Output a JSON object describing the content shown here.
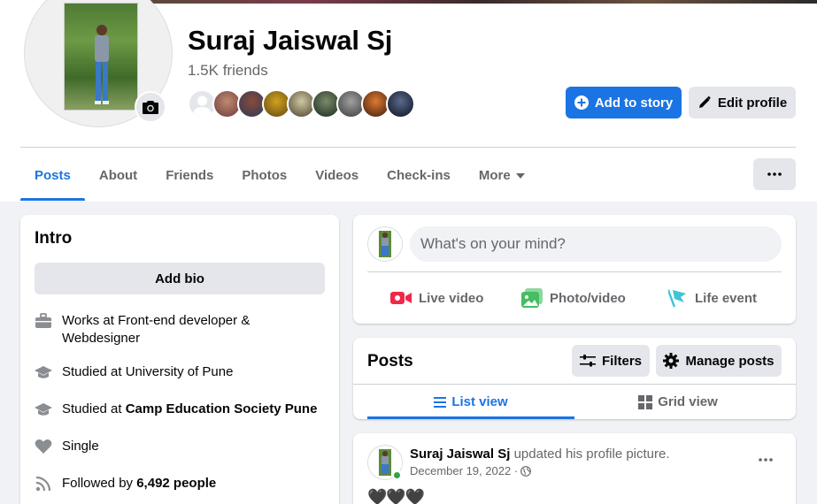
{
  "profile": {
    "name": "Suraj Jaiswal Sj",
    "friends_count": "1.5K friends",
    "add_to_story_label": "Add to story",
    "edit_profile_label": "Edit profile"
  },
  "tabs": [
    {
      "label": "Posts",
      "active": true
    },
    {
      "label": "About"
    },
    {
      "label": "Friends"
    },
    {
      "label": "Photos"
    },
    {
      "label": "Videos"
    },
    {
      "label": "Check-ins"
    },
    {
      "label": "More"
    }
  ],
  "intro": {
    "title": "Intro",
    "add_bio_label": "Add bio",
    "items": [
      {
        "icon": "briefcase-icon",
        "text": "Works at Front-end developer & Webdesigner"
      },
      {
        "icon": "graduation-cap-icon",
        "text": "Studied at University of Pune"
      },
      {
        "icon": "graduation-cap-icon",
        "prefix": "Studied at ",
        "bold": "Camp Education Society Pune"
      },
      {
        "icon": "heart-icon",
        "text": "Single"
      },
      {
        "icon": "rss-icon",
        "prefix": "Followed by ",
        "bold": "6,492 people"
      }
    ]
  },
  "composer": {
    "placeholder": "What's on your mind?",
    "actions": [
      {
        "icon": "live-video-icon",
        "label": "Live video",
        "color": "#f02849"
      },
      {
        "icon": "photo-video-icon",
        "label": "Photo/video",
        "color": "#45bd62"
      },
      {
        "icon": "life-event-icon",
        "label": "Life event",
        "color": "#3ec4d6"
      }
    ]
  },
  "posts_section": {
    "title": "Posts",
    "filters_label": "Filters",
    "manage_posts_label": "Manage posts",
    "list_view_label": "List view",
    "grid_view_label": "Grid view"
  },
  "post": {
    "author": "Suraj Jaiswal Sj",
    "action": "updated his profile picture.",
    "date": "December 19, 2022 · ",
    "text": "🖤🖤🖤"
  },
  "colors": {
    "accent": "#1b74e4",
    "background": "#f0f2f5",
    "secondary_button": "#e4e6eb"
  }
}
